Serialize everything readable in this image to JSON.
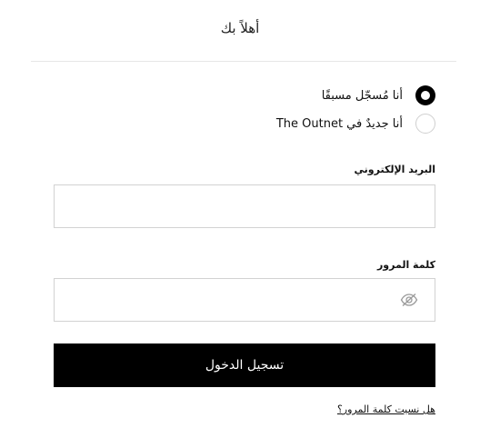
{
  "header": {
    "title": "أهلاً بك"
  },
  "account_options": [
    {
      "label": "أنا مُسجّل مسبقًا",
      "selected": true
    },
    {
      "label": "أنا جديدٌ في The Outnet",
      "selected": false
    }
  ],
  "form": {
    "email_label": "البريد الإلكتروني",
    "email_value": "",
    "password_label": "كلمة المرور",
    "password_value": "",
    "password_toggle_icon": "eye-slash-icon",
    "submit_label": "تسجيل الدخول",
    "forgot_link": "هل نسيت كلمة المرور؟"
  },
  "colors": {
    "primary_button": "#000000",
    "border": "#d2d2d2",
    "divider": "#e6e6e6"
  }
}
